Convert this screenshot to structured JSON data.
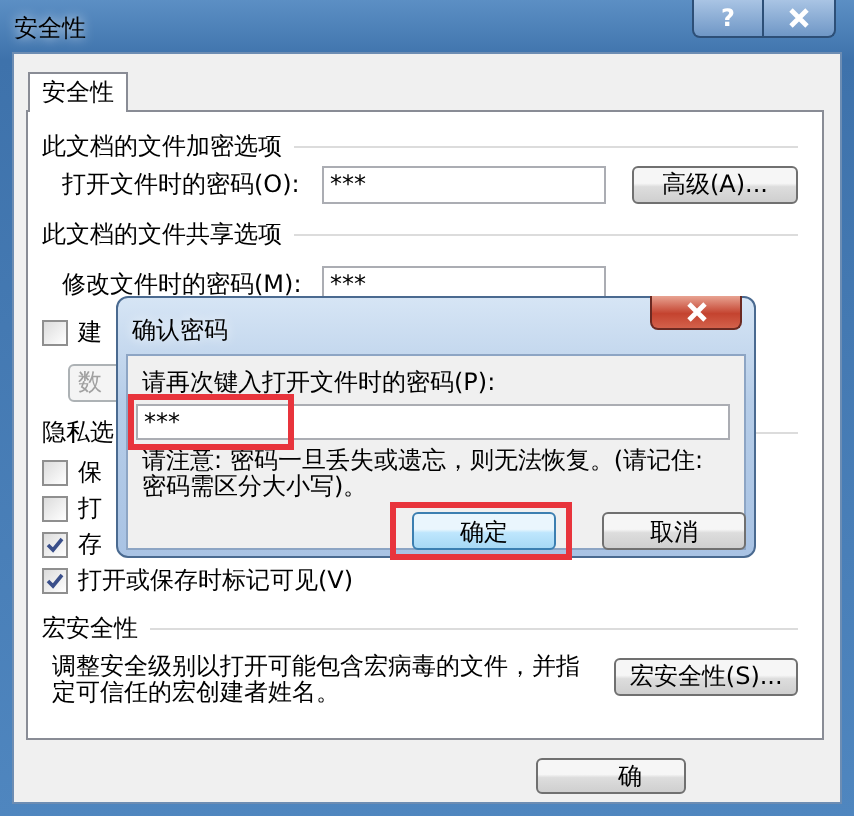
{
  "window": {
    "title": "安全性",
    "help_button": "?"
  },
  "tabs": [
    {
      "label": "安全性",
      "selected": true
    }
  ],
  "encryption": {
    "heading": "此文档的文件加密选项",
    "password_label": "打开文件时的密码(O):",
    "password_value": "***",
    "advanced_button": "高级(A)..."
  },
  "sharing": {
    "heading": "此文档的文件共享选项",
    "password_label": "修改文件时的密码(M):",
    "password_value": "***",
    "checkbox": {
      "label": "建",
      "checked": false
    },
    "button": "数"
  },
  "privacy": {
    "heading": "隐私选",
    "options": [
      {
        "label": "保",
        "checked": false
      },
      {
        "label": "打",
        "checked": false
      },
      {
        "label": "存",
        "checked": true
      },
      {
        "label": "打开或保存时标记可见(V)",
        "checked": true
      }
    ]
  },
  "macro": {
    "heading": "宏安全性",
    "description": "调整安全级别以打开可能包含宏病毒的文件，并指定可信任的宏创建者姓名。",
    "button": "宏安全性(S)..."
  },
  "footer_buttons": [
    "确"
  ],
  "dialog": {
    "title": "确认密码",
    "prompt": "请再次键入打开文件时的密码(P):",
    "password_value": "***",
    "password_highlighted": true,
    "note": "请注意: 密码一旦丢失或遗忘，则无法恢复。(请记住: 密码需区分大小写)。",
    "buttons": [
      {
        "label": "确定",
        "default": true,
        "highlighted": true
      },
      {
        "label": "取消",
        "default": false,
        "highlighted": false
      }
    ]
  }
}
